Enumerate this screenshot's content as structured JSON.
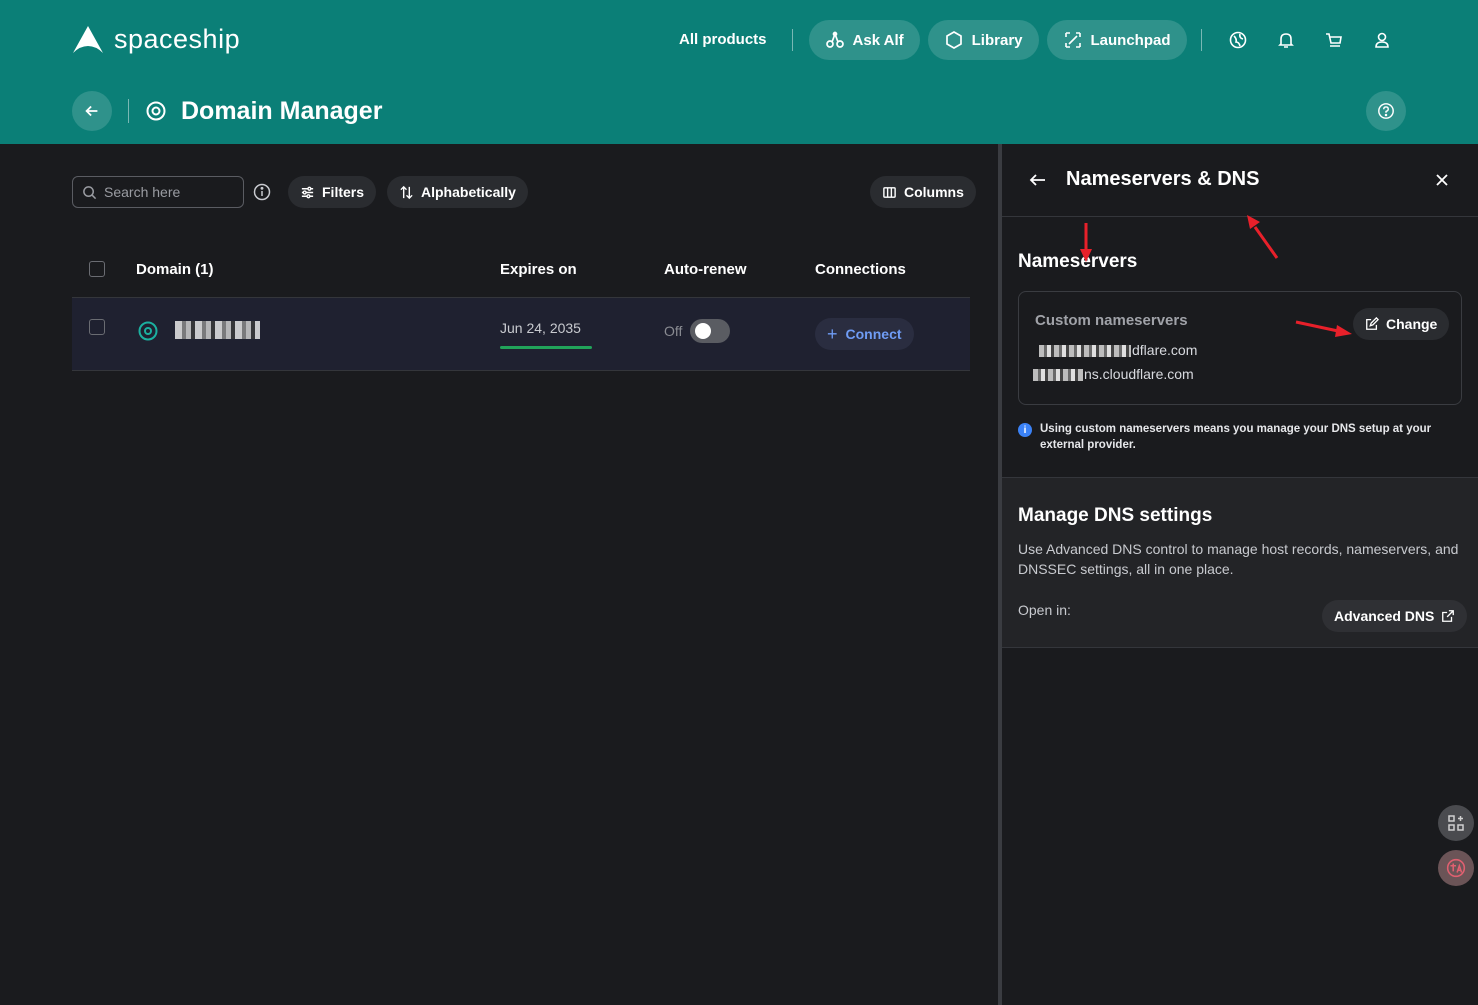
{
  "brand": {
    "name": "spaceship"
  },
  "nav": {
    "all_products": "All products",
    "ask_alf": "Ask Alf",
    "library": "Library",
    "launchpad": "Launchpad"
  },
  "page": {
    "title": "Domain Manager"
  },
  "toolbar": {
    "search_placeholder": "Search here",
    "filters": "Filters",
    "sort": "Alphabetically",
    "columns": "Columns"
  },
  "table": {
    "columns": [
      "Domain (1)",
      "Expires on",
      "Auto-renew",
      "Connections"
    ],
    "rows": [
      {
        "domain": "",
        "expires": "Jun 24, 2035",
        "autorenew_label": "Off",
        "autorenew_on": false,
        "connect_label": "Connect"
      }
    ]
  },
  "panel": {
    "title": "Nameservers & DNS",
    "nameservers": {
      "heading": "Nameservers",
      "card_label": "Custom nameservers",
      "change_label": "Change",
      "ns1_visible": "dflare.com",
      "ns2_visible": "ns.cloudflare.com",
      "note": "Using custom nameservers means you manage your DNS setup at your external provider."
    },
    "dns": {
      "heading": "Manage DNS settings",
      "description": "Use Advanced DNS control to manage host records, nameservers, and DNSSEC settings, all in one place.",
      "open_in": "Open in:",
      "advanced_label": "Advanced DNS"
    }
  },
  "colors": {
    "header_bg": "#0b7f77",
    "body_bg": "#1a1b1e",
    "accent_blue": "#6f9cf5",
    "progress_green": "#21a35a",
    "annotation_red": "#e8202a"
  }
}
